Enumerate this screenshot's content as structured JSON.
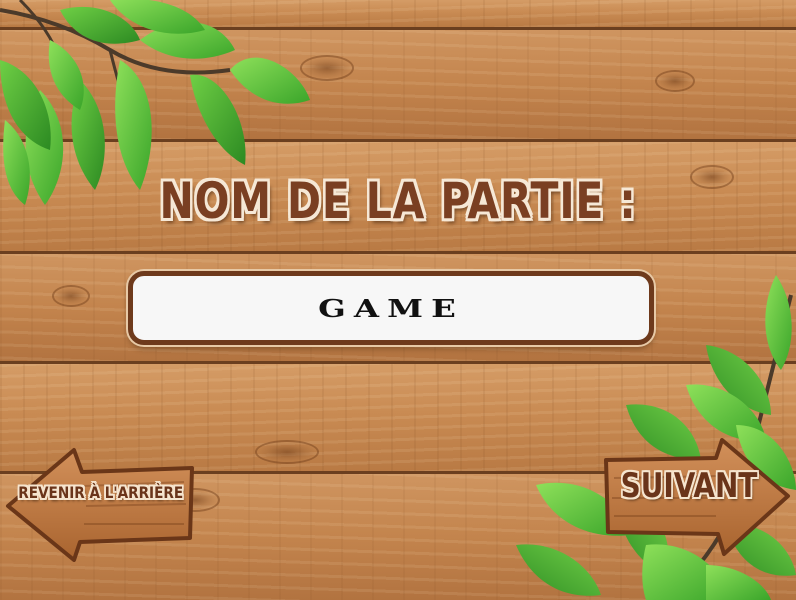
{
  "screen": {
    "title": "NOM DE LA PARTIE :",
    "game_name_value": "GAME"
  },
  "buttons": {
    "back_label": "REVENIR À L'ARRIÈRE",
    "next_label": "SUIVANT"
  },
  "colors": {
    "title_text": "#7a3f22",
    "title_outline": "#f6e8d6",
    "field_border": "#6e3a1c",
    "field_fill": "#f7f7f7",
    "sign_wood": "#c07a45",
    "leaf_green": "#57c23a"
  },
  "icons": {
    "background": "wooden-planks",
    "decoration": "green-leaves",
    "back_shape": "wooden-arrow-left",
    "next_shape": "wooden-arrow-right"
  }
}
